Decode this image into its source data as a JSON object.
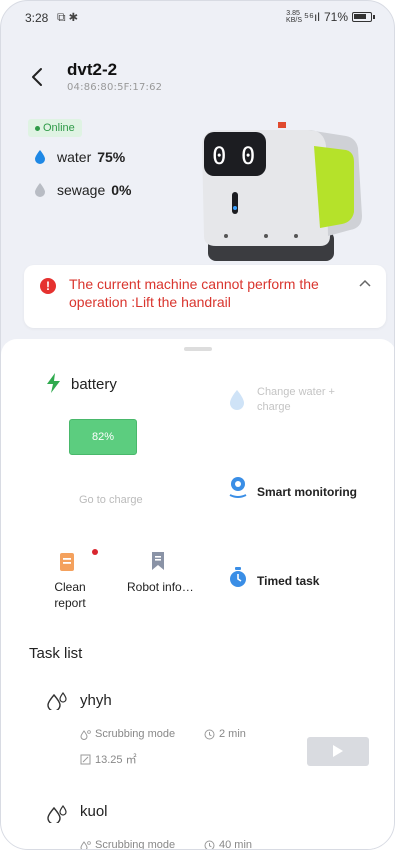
{
  "status_bar": {
    "time": "3:28",
    "icons_left": "⧉ ✱",
    "speed": "3.85 KB/S",
    "signal": "⁵⁶ıl",
    "battery": "71%"
  },
  "header": {
    "title": "dvt2-2",
    "mac": "04:86:80:5F:17:62"
  },
  "device": {
    "status": "Online",
    "water_label": "water",
    "water_value": "75%",
    "sewage_label": "sewage",
    "sewage_value": "0%",
    "screen_text": "0 0"
  },
  "alert": {
    "message": "The current machine cannot perform the operation :Lift the handrail"
  },
  "battery": {
    "title": "battery",
    "percent": "82%",
    "level": 0.82,
    "go_to_charge": "Go to charge"
  },
  "actions": {
    "change_water": "Change water + charge",
    "smart_monitoring": "Smart monitoring",
    "clean_report": "Clean report",
    "robot_info": "Robot informati...",
    "timed_task": "Timed task"
  },
  "tasks": {
    "title": "Task list",
    "items": [
      {
        "name": "yhyh",
        "mode": "Scrubbing mode",
        "duration": "2 min",
        "area": "13.25 ㎡"
      },
      {
        "name": "kuol",
        "mode": "Scrubbing mode",
        "duration": "40 min"
      }
    ]
  },
  "colors": {
    "accent_green": "#5ccd7f",
    "alert_red": "#d9352e",
    "water_blue": "#1e88e5",
    "robot_lime": "#b5e22a"
  }
}
